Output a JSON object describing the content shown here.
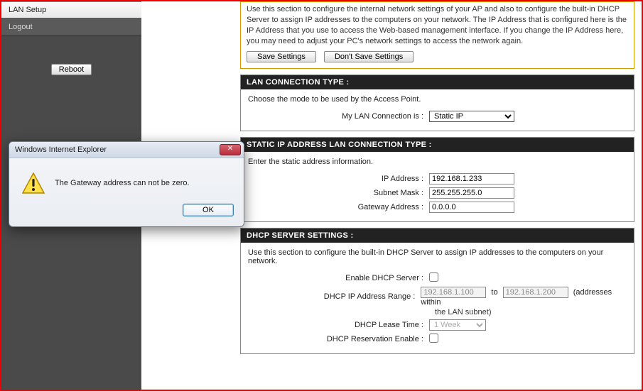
{
  "sidebar": {
    "items": [
      {
        "label": "LAN Setup"
      },
      {
        "label": "Logout"
      }
    ],
    "reboot_label": "Reboot"
  },
  "intro": {
    "text": "Use this section to configure the internal network settings of your AP and also to configure the built-in DHCP Server to assign IP addresses to the computers on your network. The IP Address that is configured here is the IP Address that you use to access the Web-based management interface. If you change the IP Address here, you may need to adjust your PC's network settings to access the network again.",
    "save_label": "Save Settings",
    "dont_save_label": "Don't Save Settings"
  },
  "lan_conn": {
    "header": "LAN CONNECTION TYPE :",
    "desc": "Choose the mode to be used by the Access Point.",
    "label": "My LAN Connection is :",
    "selected": "Static IP"
  },
  "static_ip": {
    "header": "STATIC IP ADDRESS LAN CONNECTION TYPE :",
    "desc": "Enter the static address information.",
    "ip_label": "IP Address :",
    "ip_value": "192.168.1.233",
    "subnet_label": "Subnet Mask :",
    "subnet_value": "255.255.255.0",
    "gateway_label": "Gateway Address :",
    "gateway_value": "0.0.0.0"
  },
  "dhcp": {
    "header": "DHCP SERVER SETTINGS :",
    "desc": "Use this section to configure the built-in DHCP Server to assign IP addresses to the computers on your network.",
    "enable_label": "Enable DHCP Server :",
    "range_label": "DHCP IP Address Range :",
    "range_start": "192.168.1.100",
    "range_to": "to",
    "range_end": "192.168.1.200",
    "range_suffix": "(addresses within",
    "range_suffix2": "the LAN subnet)",
    "lease_label": "DHCP Lease Time :",
    "lease_value": "1 Week",
    "reservation_label": "DHCP Reservation Enable :"
  },
  "dialog": {
    "title": "Windows Internet Explorer",
    "close": "✕",
    "message": "The Gateway address can not be zero.",
    "ok_label": "OK"
  }
}
